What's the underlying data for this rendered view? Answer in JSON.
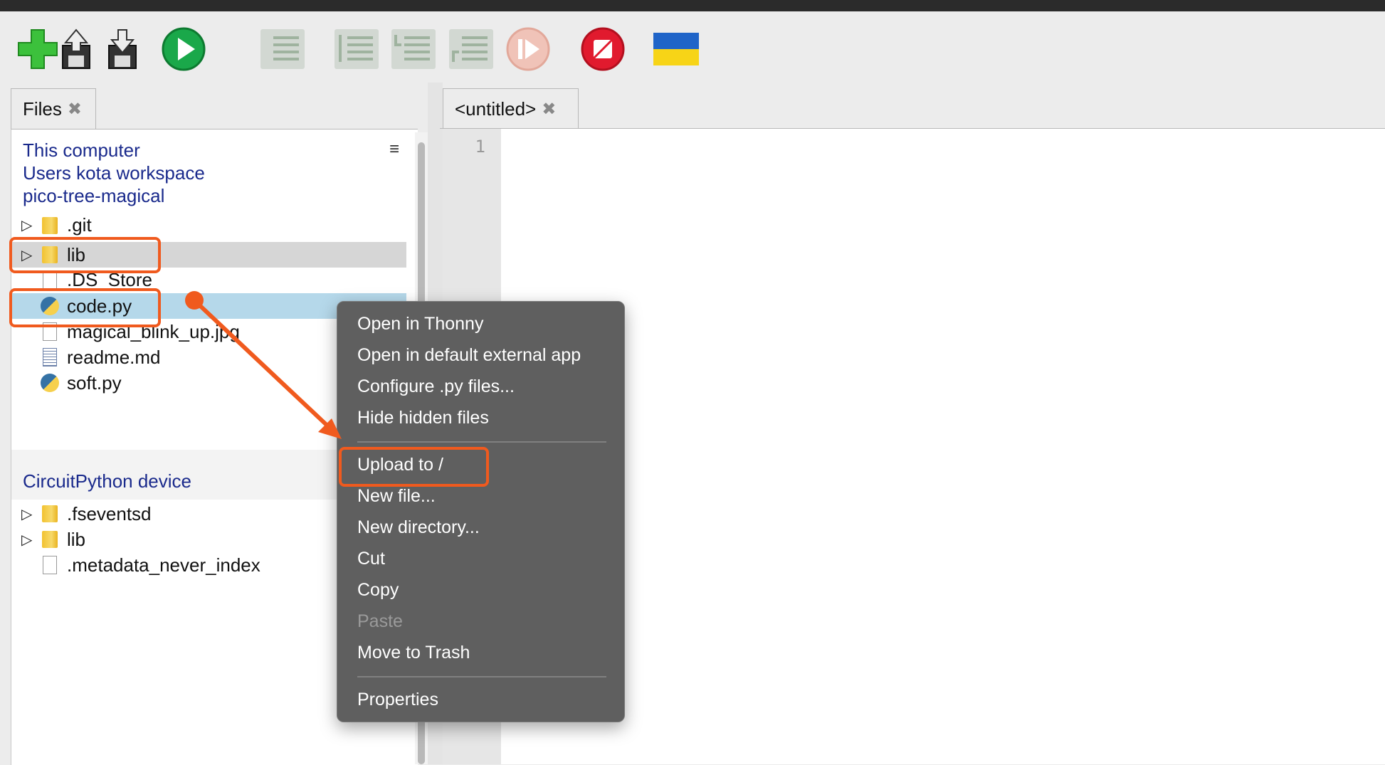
{
  "toolbar": {
    "buttons": [
      "new-file",
      "load",
      "save",
      "run",
      "debug",
      "step-over",
      "step-into",
      "step-out",
      "resume",
      "stop",
      "support-ukraine"
    ]
  },
  "files_panel": {
    "tab_label": "Files",
    "local": {
      "header": "This computer",
      "path_sep": "/",
      "path": [
        "Users",
        "kota",
        "workspace"
      ],
      "project": "pico-tree-magical",
      "items": [
        ".git",
        "lib",
        ".DS_Store",
        "code.py",
        "magical_blink_up.jpg",
        "readme.md",
        "soft.py"
      ]
    },
    "device": {
      "header": "CircuitPython device",
      "items": [
        ".fseventsd",
        "lib",
        ".metadata_never_index"
      ]
    }
  },
  "editor": {
    "tab_label": "<untitled>",
    "line_number": "1"
  },
  "context_menu": {
    "items": [
      "Open in Thonny",
      "Open in default external app",
      "Configure .py files...",
      "Hide hidden files",
      "Upload to /",
      "New file...",
      "New directory...",
      "Cut",
      "Copy",
      "Paste",
      "Move to Trash",
      "Properties"
    ]
  },
  "colors": {
    "annotation": "#f05a1e",
    "link_blue": "#1a2a8c",
    "selection": "#b5d8ea"
  }
}
